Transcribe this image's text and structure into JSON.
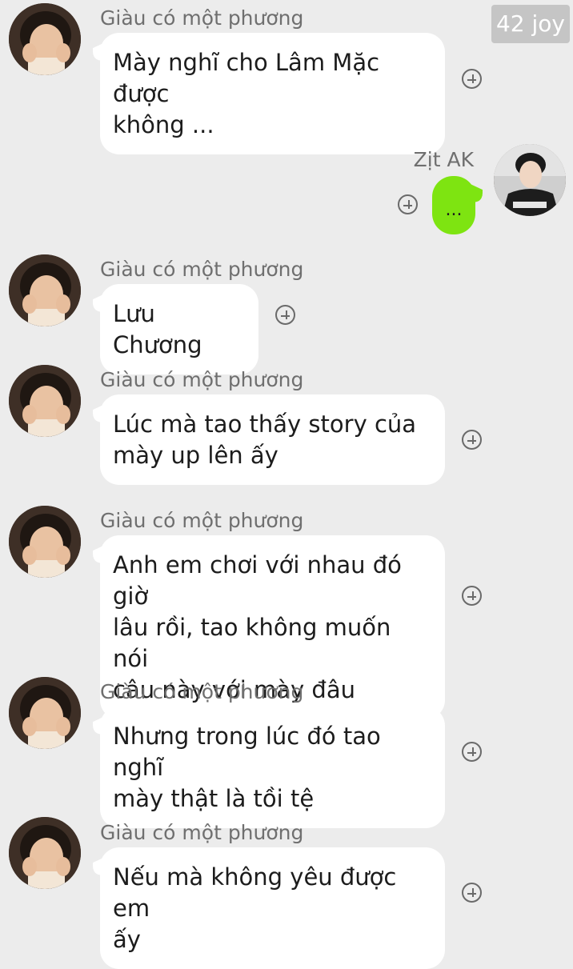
{
  "watermark": "42 joy",
  "messages": [
    {
      "sender": "Giàu có một phương",
      "direction": "incoming",
      "text": "Mày nghĩ cho Lâm Mặc được\nkhông ..."
    },
    {
      "sender": "Zịt AK",
      "direction": "outgoing",
      "text": "..."
    },
    {
      "sender": "Giàu có một phương",
      "direction": "incoming",
      "text": "Lưu Chương"
    },
    {
      "sender": "Giàu có một phương",
      "direction": "incoming",
      "text": "Lúc mà tao thấy story của\nmày up lên ấy"
    },
    {
      "sender": "Giàu có một phương",
      "direction": "incoming",
      "text": "Anh em chơi với nhau đó giờ\nlâu rồi, tao không muốn nói\ncâu này với mày đâu"
    },
    {
      "sender": "Giàu có một phương",
      "direction": "incoming",
      "text": "Nhưng trong lúc đó tao nghĩ\nmày thật là tồi tệ"
    },
    {
      "sender": "Giàu có một phương",
      "direction": "incoming",
      "text": "Nếu mà không yêu được em\nấy"
    }
  ],
  "icons": {
    "add_reaction": "plus-circle-icon",
    "avatar_incoming": "user-avatar",
    "avatar_outgoing": "user-avatar"
  },
  "colors": {
    "background": "#ececec",
    "incoming_bubble": "#ffffff",
    "outgoing_bubble": "#7ee411"
  }
}
